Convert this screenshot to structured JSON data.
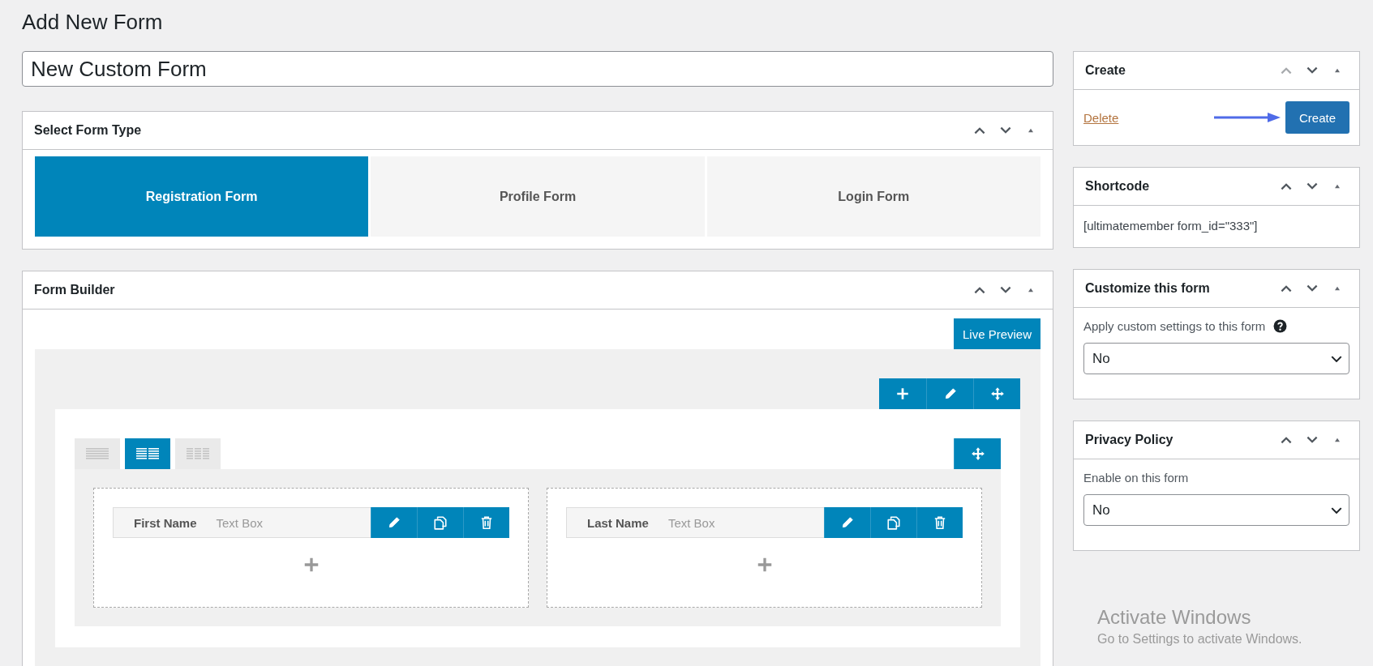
{
  "page_title": "Add New Form",
  "form_title": {
    "value": "New Custom Form"
  },
  "select_form_type": {
    "title": "Select Form Type",
    "up_disabled": false,
    "types": [
      {
        "label": "Registration Form",
        "selected": true
      },
      {
        "label": "Profile Form",
        "selected": false
      },
      {
        "label": "Login Form",
        "selected": false
      }
    ]
  },
  "form_builder": {
    "title": "Form Builder",
    "up_disabled": false,
    "live_preview": "Live Preview",
    "layout_tabs": [
      {
        "selected": false
      },
      {
        "selected": true
      },
      {
        "selected": false
      }
    ],
    "columns": [
      {
        "fields": [
          {
            "label": "First Name",
            "type": "Text Box"
          }
        ]
      },
      {
        "fields": [
          {
            "label": "Last Name",
            "type": "Text Box"
          }
        ]
      }
    ]
  },
  "sidebar": [
    {
      "kind": "create",
      "title": "Create",
      "up_disabled": true,
      "delete_link": "Delete",
      "button": "Create"
    },
    {
      "kind": "shortcode",
      "title": "Shortcode",
      "up_disabled": false,
      "text": "[ultimatemember form_id=\"333\"]"
    },
    {
      "kind": "select",
      "title": "Customize this form",
      "up_disabled": false,
      "label": "Apply custom settings to this form",
      "help": true,
      "value": "No"
    },
    {
      "kind": "select",
      "title": "Privacy Policy",
      "up_disabled": false,
      "label": "Enable on this form",
      "help": false,
      "value": "No"
    }
  ],
  "os_notice": {
    "title": "Activate Windows",
    "text": "Go to Settings to activate Windows."
  }
}
